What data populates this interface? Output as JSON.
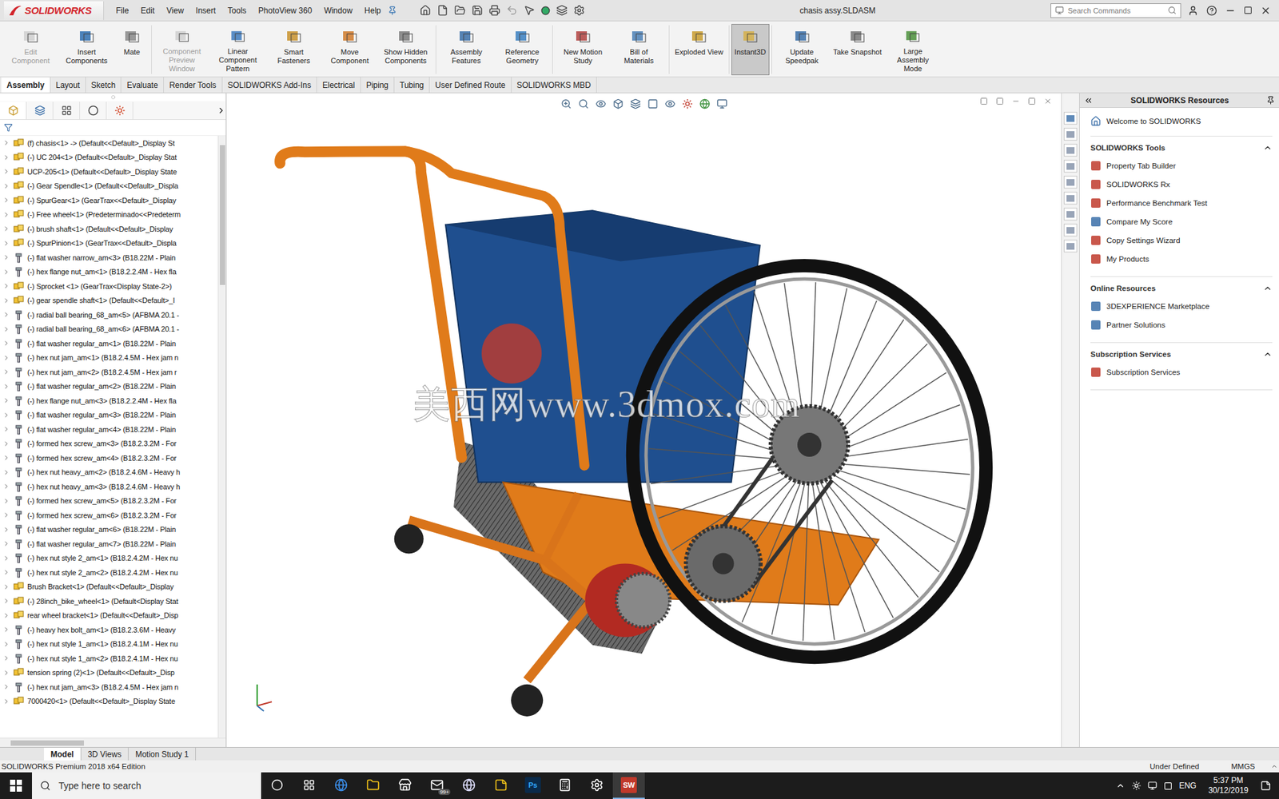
{
  "window": {
    "title": "chasis assy.SLDASM",
    "logo": "SOLIDWORKS"
  },
  "menu": [
    "File",
    "Edit",
    "View",
    "Insert",
    "Tools",
    "PhotoView 360",
    "Window",
    "Help"
  ],
  "search": {
    "placeholder": "Search Commands"
  },
  "ribbon": [
    {
      "label": "Edit Component",
      "disabled": true,
      "selected": false
    },
    {
      "label": "Insert Components",
      "disabled": false,
      "selected": false
    },
    {
      "label": "Mate",
      "disabled": false,
      "selected": false
    },
    {
      "label": "Component Preview Window",
      "disabled": true,
      "selected": false
    },
    {
      "label": "Linear Component Pattern",
      "disabled": false,
      "selected": false
    },
    {
      "label": "Smart Fasteners",
      "disabled": false,
      "selected": false
    },
    {
      "label": "Move Component",
      "disabled": false,
      "selected": false
    },
    {
      "label": "Show Hidden Components",
      "disabled": false,
      "selected": false
    },
    {
      "label": "Assembly Features",
      "disabled": false,
      "selected": false
    },
    {
      "label": "Reference Geometry",
      "disabled": false,
      "selected": false
    },
    {
      "label": "New Motion Study",
      "disabled": false,
      "selected": false
    },
    {
      "label": "Bill of Materials",
      "disabled": false,
      "selected": false
    },
    {
      "label": "Exploded View",
      "disabled": false,
      "selected": false
    },
    {
      "label": "Instant3D",
      "disabled": false,
      "selected": true
    },
    {
      "label": "Update Speedpak",
      "disabled": false,
      "selected": false
    },
    {
      "label": "Take Snapshot",
      "disabled": false,
      "selected": false
    },
    {
      "label": "Large Assembly Mode",
      "disabled": false,
      "selected": false
    }
  ],
  "tabs": [
    {
      "label": "Assembly",
      "selected": true
    },
    {
      "label": "Layout",
      "selected": false
    },
    {
      "label": "Sketch",
      "selected": false
    },
    {
      "label": "Evaluate",
      "selected": false
    },
    {
      "label": "Render Tools",
      "selected": false
    },
    {
      "label": "SOLIDWORKS Add-Ins",
      "selected": false
    },
    {
      "label": "Electrical",
      "selected": false
    },
    {
      "label": "Piping",
      "selected": false
    },
    {
      "label": "Tubing",
      "selected": false
    },
    {
      "label": "User Defined Route",
      "selected": false
    },
    {
      "label": "SOLIDWORKS MBD",
      "selected": false
    }
  ],
  "tree": {
    "items": [
      {
        "label": "(f) chasis<1> -> (Default<<Default>_Display St",
        "kind": "assembly"
      },
      {
        "label": "(-) UC 204<1> (Default<<Default>_Display Stat",
        "kind": "assembly"
      },
      {
        "label": "UCP-205<1> (Default<<Default>_Display State",
        "kind": "assembly"
      },
      {
        "label": "(-) Gear Spendle<1> (Default<<Default>_Displa",
        "kind": "assembly"
      },
      {
        "label": "(-) SpurGear<1> (GearTrax<<Default>_Display",
        "kind": "assembly"
      },
      {
        "label": "(-) Free wheel<1> (Predeterminado<<Predeterm",
        "kind": "assembly"
      },
      {
        "label": "(-) brush shaft<1> (Default<<Default>_Display",
        "kind": "assembly"
      },
      {
        "label": "(-) SpurPinion<1> (GearTrax<<Default>_Displa",
        "kind": "assembly"
      },
      {
        "label": "(-) flat washer narrow_am<3> (B18.22M - Plain",
        "kind": "part"
      },
      {
        "label": "(-) hex flange nut_am<1> (B18.2.2.4M - Hex fla",
        "kind": "part"
      },
      {
        "label": "(-) Sprocket <1> (GearTrax<Display State-2>)",
        "kind": "assembly"
      },
      {
        "label": "(-) gear spendle shaft<1> (Default<<Default>_I",
        "kind": "assembly"
      },
      {
        "label": "(-) radial ball bearing_68_am<5> (AFBMA 20.1 -",
        "kind": "part"
      },
      {
        "label": "(-) radial ball bearing_68_am<6> (AFBMA 20.1 -",
        "kind": "part"
      },
      {
        "label": "(-) flat washer regular_am<1> (B18.22M - Plain",
        "kind": "part"
      },
      {
        "label": "(-) hex nut jam_am<1> (B18.2.4.5M - Hex jam n",
        "kind": "part"
      },
      {
        "label": "(-) hex nut jam_am<2> (B18.2.4.5M - Hex jam r",
        "kind": "part"
      },
      {
        "label": "(-) flat washer regular_am<2> (B18.22M - Plain",
        "kind": "part"
      },
      {
        "label": "(-) hex flange nut_am<3> (B18.2.2.4M - Hex fla",
        "kind": "part"
      },
      {
        "label": "(-) flat washer regular_am<3> (B18.22M - Plain",
        "kind": "part"
      },
      {
        "label": "(-) flat washer regular_am<4> (B18.22M - Plain",
        "kind": "part"
      },
      {
        "label": "(-) formed hex screw_am<3> (B18.2.3.2M - For",
        "kind": "part"
      },
      {
        "label": "(-) formed hex screw_am<4> (B18.2.3.2M - For",
        "kind": "part"
      },
      {
        "label": "(-) hex nut heavy_am<2> (B18.2.4.6M - Heavy h",
        "kind": "part"
      },
      {
        "label": "(-) hex nut heavy_am<3> (B18.2.4.6M - Heavy h",
        "kind": "part"
      },
      {
        "label": "(-) formed hex screw_am<5> (B18.2.3.2M - For",
        "kind": "part"
      },
      {
        "label": "(-) formed hex screw_am<6> (B18.2.3.2M - For",
        "kind": "part"
      },
      {
        "label": "(-) flat washer regular_am<6> (B18.22M - Plain",
        "kind": "part"
      },
      {
        "label": "(-) flat washer regular_am<7> (B18.22M - Plain",
        "kind": "part"
      },
      {
        "label": "(-) hex nut style 2_am<1> (B18.2.4.2M - Hex nu",
        "kind": "part"
      },
      {
        "label": "(-) hex nut style 2_am<2> (B18.2.4.2M - Hex nu",
        "kind": "part"
      },
      {
        "label": "Brush Bracket<1> (Default<<Default>_Display",
        "kind": "assembly"
      },
      {
        "label": "(-) 28inch_bike_wheel<1> (Default<Display Stat",
        "kind": "assembly"
      },
      {
        "label": "rear wheel bracket<1> (Default<<Default>_Disp",
        "kind": "assembly"
      },
      {
        "label": "(-) heavy hex bolt_am<1> (B18.2.3.6M - Heavy",
        "kind": "part"
      },
      {
        "label": "(-) hex nut style 1_am<1> (B18.2.4.1M - Hex nu",
        "kind": "part"
      },
      {
        "label": "(-) hex nut style 1_am<2> (B18.2.4.1M - Hex nu",
        "kind": "part"
      },
      {
        "label": "tension spring (2)<1> (Default<<Default>_Disp",
        "kind": "assembly"
      },
      {
        "label": "(-) hex nut jam_am<3> (B18.2.4.5M - Hex jam n",
        "kind": "part"
      },
      {
        "label": "7000420<1> (Default<<Default>_Display State",
        "kind": "assembly"
      }
    ]
  },
  "viewport": {
    "watermark": "美西网www.3dmox.com"
  },
  "resources": {
    "title": "SOLIDWORKS Resources",
    "welcome": "Welcome to SOLIDWORKS",
    "sections": [
      {
        "title": "SOLIDWORKS Tools",
        "expanded": true,
        "items": [
          "Property Tab Builder",
          "SOLIDWORKS Rx",
          "Performance Benchmark Test",
          "Compare My Score",
          "Copy Settings Wizard",
          "My Products"
        ]
      },
      {
        "title": "Online Resources",
        "expanded": true,
        "items": [
          "3DEXPERIENCE Marketplace",
          "Partner Solutions"
        ]
      },
      {
        "title": "Subscription Services",
        "expanded": true,
        "items": [
          "Subscription Services"
        ]
      }
    ]
  },
  "bottom_tabs": [
    {
      "label": "Model",
      "selected": true
    },
    {
      "label": "3D Views",
      "selected": false
    },
    {
      "label": "Motion Study 1",
      "selected": false
    }
  ],
  "status_bar": {
    "edition": "SOLIDWORKS Premium 2018 x64 Edition",
    "state": "Under Defined",
    "units": "MMGS"
  },
  "taskbar": {
    "search": "Type here to search",
    "apps": [
      {
        "name": "cortana",
        "glyph": "",
        "badge": "",
        "selected": false
      },
      {
        "name": "task-view",
        "glyph": "",
        "badge": "",
        "selected": false
      },
      {
        "name": "edge",
        "glyph": "",
        "badge": "",
        "selected": false
      },
      {
        "name": "explorer",
        "glyph": "",
        "badge": "",
        "selected": false
      },
      {
        "name": "store",
        "glyph": "",
        "badge": "",
        "selected": false
      },
      {
        "name": "mail",
        "glyph": "",
        "badge": "99+",
        "selected": false
      },
      {
        "name": "browser",
        "glyph": "",
        "badge": "",
        "selected": false
      },
      {
        "name": "sticky-notes",
        "glyph": "",
        "badge": "",
        "selected": false
      },
      {
        "name": "photoshop",
        "glyph": "Ps",
        "badge": "",
        "selected": false
      },
      {
        "name": "calculator",
        "glyph": "",
        "badge": "",
        "selected": false
      },
      {
        "name": "app",
        "glyph": "",
        "badge": "",
        "selected": false
      },
      {
        "name": "solidworks",
        "glyph": "SW",
        "badge": "",
        "selected": true
      }
    ],
    "language": "ENG",
    "time": "5:37 PM",
    "date": "30/12/2019"
  }
}
